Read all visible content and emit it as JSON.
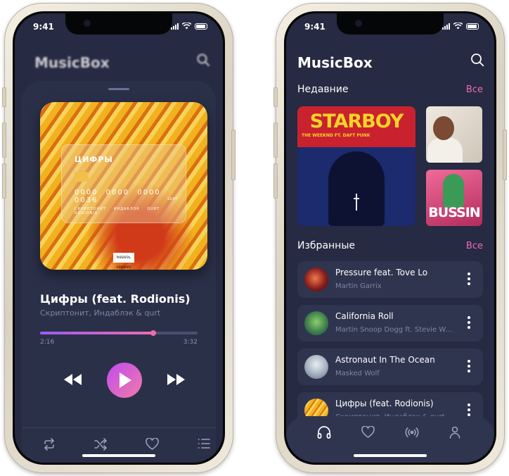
{
  "status": {
    "time": "9:41"
  },
  "app": {
    "title": "MusicBox"
  },
  "player": {
    "song_title": "Цифры (feat. Rodionis)",
    "artist": "Скриптонит, Индаблэк & qurt",
    "elapsed": "2:16",
    "duration": "3:32",
    "progress": 0.72,
    "cover": {
      "card_title": "ЦИФРЫ",
      "card_number": "0000 0000 0000 0036",
      "card_names": "СКРИПТОНИТ ИНДАБЛЭК QURT RODIONIS",
      "card_exp": "12/47",
      "advisory": "PARENTAL ADVISORY EXPLICIT CONTENT"
    }
  },
  "home": {
    "recent_label": "Недавние",
    "recent_all": "Все",
    "favorites_label": "Избранные",
    "favorites_all": "Все",
    "recent": [
      {
        "title": "STARBOY",
        "subtitle": "THE WEEKND FT. DAFT PUNK"
      },
      {
        "title": ""
      },
      {
        "title": "BUSSIN"
      }
    ],
    "favorites": [
      {
        "title": "Pressure feat. Tove Lo",
        "artist": "Martin Garrix"
      },
      {
        "title": "California Roll",
        "artist": "Martin Snoop Dogg ft. Stevie Wonder"
      },
      {
        "title": "Astronaut In The Ocean",
        "artist": "Masked Wolf"
      },
      {
        "title": "Цифры (feat. Rodionis)",
        "artist": "Скриптонит, Индаблэк & qurt"
      }
    ]
  },
  "colors": {
    "background": "#262a42",
    "card": "#30354f",
    "accent_pink": "#f06bb0",
    "accent_purple": "#9b5cf2"
  },
  "icons": {
    "search": "search-icon",
    "prev": "rewind-icon",
    "play": "play-icon",
    "next": "fast-forward-icon",
    "repeat": "repeat-icon",
    "shuffle": "shuffle-icon",
    "heart": "heart-icon",
    "queue": "list-icon",
    "headphones": "headphones-icon",
    "radio": "radio-icon",
    "profile": "profile-icon"
  }
}
